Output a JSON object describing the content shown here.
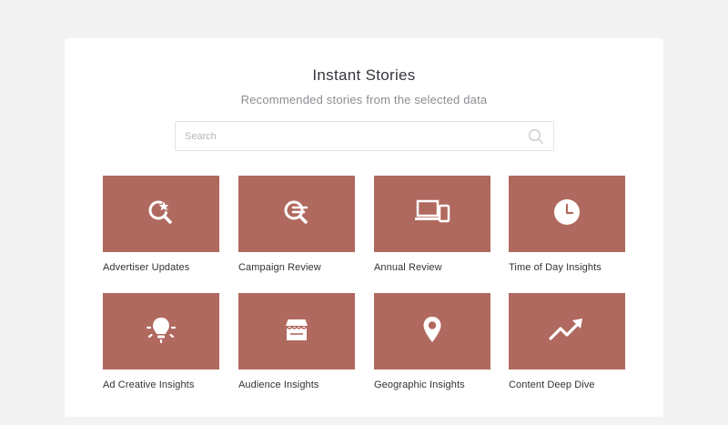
{
  "header": {
    "title": "Instant Stories",
    "subtitle": "Recommended stories from the selected data"
  },
  "search": {
    "placeholder": "Search",
    "value": ""
  },
  "colors": {
    "tile": "#b0695e",
    "background": "#f3f3f3",
    "panel": "#ffffff"
  },
  "stories": [
    {
      "label": "Advertiser Updates",
      "icon": "search-star-icon"
    },
    {
      "label": "Campaign Review",
      "icon": "search-list-icon"
    },
    {
      "label": "Annual Review",
      "icon": "devices-icon"
    },
    {
      "label": "Time of Day Insights",
      "icon": "clock-icon"
    },
    {
      "label": "Ad Creative Insights",
      "icon": "lightbulb-icon"
    },
    {
      "label": "Audience Insights",
      "icon": "storefront-icon"
    },
    {
      "label": "Geographic Insights",
      "icon": "map-pin-icon"
    },
    {
      "label": "Content Deep Dive",
      "icon": "trend-up-icon"
    }
  ]
}
